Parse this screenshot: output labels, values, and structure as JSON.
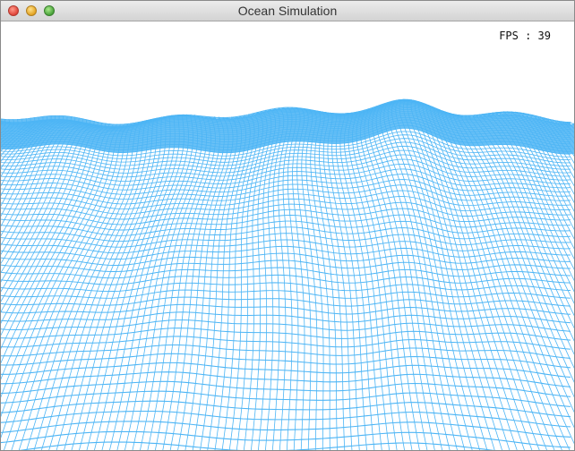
{
  "window": {
    "title": "Ocean Simulation"
  },
  "hud": {
    "fps_text": "FPS : 39"
  },
  "colors": {
    "wireframe": "#4db5f5",
    "background": "#ffffff"
  },
  "icons": {
    "close": "close-icon",
    "minimize": "minimize-icon",
    "zoom": "zoom-icon"
  }
}
